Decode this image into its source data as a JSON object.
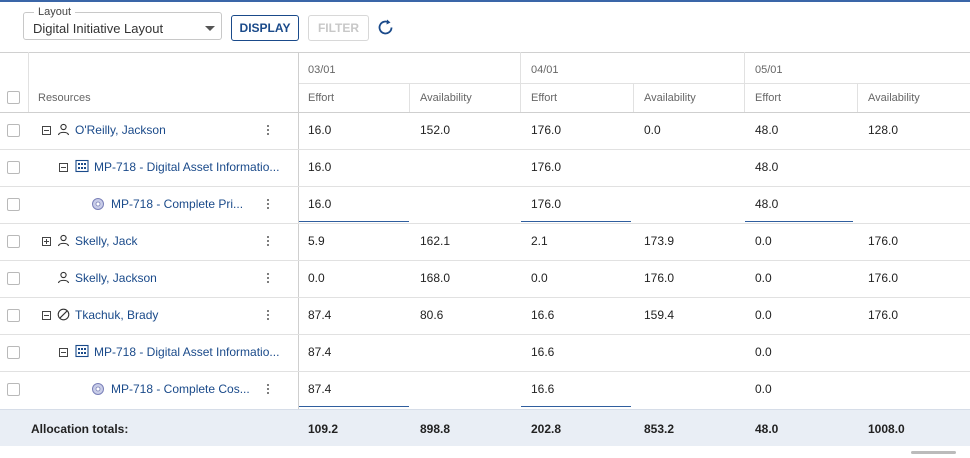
{
  "toolbar": {
    "layout_label": "Layout",
    "layout_value": "Digital Initiative Layout",
    "display_label": "DISPLAY",
    "filter_label": "FILTER"
  },
  "grid": {
    "resources_header": "Resources",
    "periods": [
      {
        "label": "03/01",
        "effort": "Effort",
        "availability": "Availability"
      },
      {
        "label": "04/01",
        "effort": "Effort",
        "availability": "Availability"
      },
      {
        "label": "05/01",
        "effort": "Effort",
        "availability": "Availability"
      }
    ],
    "rows": [
      {
        "name": "O'Reilly, Jackson",
        "values": [
          "16.0",
          "152.0",
          "176.0",
          "0.0",
          "48.0",
          "128.0"
        ]
      },
      {
        "name": "MP-718 - Digital Asset Informatio...",
        "values": [
          "16.0",
          "",
          "176.0",
          "",
          "48.0",
          ""
        ]
      },
      {
        "name": "MP-718 - Complete Pri...",
        "values": [
          "16.0",
          "",
          "176.0",
          "",
          "48.0",
          ""
        ]
      },
      {
        "name": "Skelly, Jack",
        "values": [
          "5.9",
          "162.1",
          "2.1",
          "173.9",
          "0.0",
          "176.0"
        ]
      },
      {
        "name": "Skelly, Jackson",
        "values": [
          "0.0",
          "168.0",
          "0.0",
          "176.0",
          "0.0",
          "176.0"
        ]
      },
      {
        "name": "Tkachuk, Brady",
        "values": [
          "87.4",
          "80.6",
          "16.6",
          "159.4",
          "0.0",
          "176.0"
        ]
      },
      {
        "name": "MP-718 - Digital Asset Informatio...",
        "values": [
          "87.4",
          "",
          "16.6",
          "",
          "0.0",
          ""
        ]
      },
      {
        "name": "MP-718 - Complete Cos...",
        "values": [
          "87.4",
          "",
          "16.6",
          "",
          "0.0",
          ""
        ]
      }
    ],
    "totals": {
      "label": "Allocation totals:",
      "values": [
        "109.2",
        "898.8",
        "202.8",
        "853.2",
        "48.0",
        "1008.0"
      ]
    }
  }
}
